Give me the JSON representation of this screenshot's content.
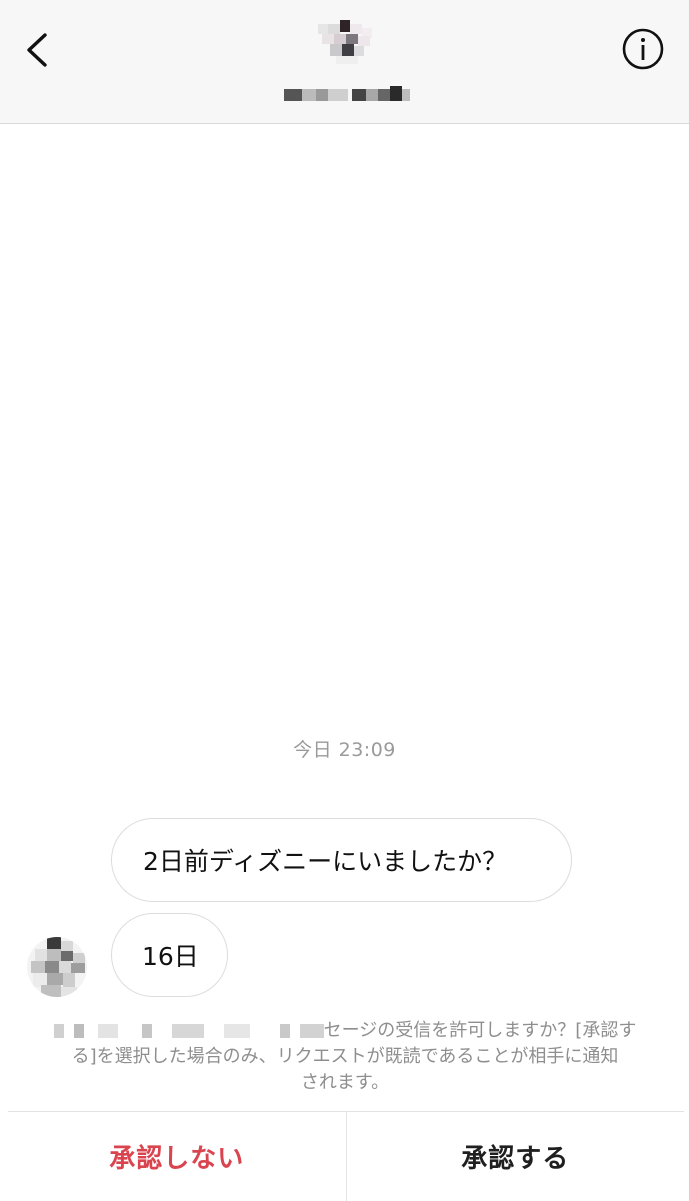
{
  "header": {
    "back_icon": "chevron-left-icon",
    "info_icon": "info-icon",
    "name_redacted": true
  },
  "conversation": {
    "timestamp": "今日 23:09",
    "messages": [
      {
        "text": "2日前ディズニーにいましたか？"
      },
      {
        "text": "16日"
      }
    ]
  },
  "request_notice": {
    "visible_text_line1": "セージの受信を許可しますか？[承認す",
    "visible_text_line2": "る]を選択した場合のみ、リクエストが既読であることが相手に通知",
    "visible_text_line3": "されます。"
  },
  "actions": {
    "decline_label": "承認しない",
    "accept_label": "承認する"
  },
  "colors": {
    "decline": "#d9444f",
    "accept": "#1f1f1f",
    "header_bg": "#f7f7f7",
    "muted_text": "#8e8e8e"
  }
}
